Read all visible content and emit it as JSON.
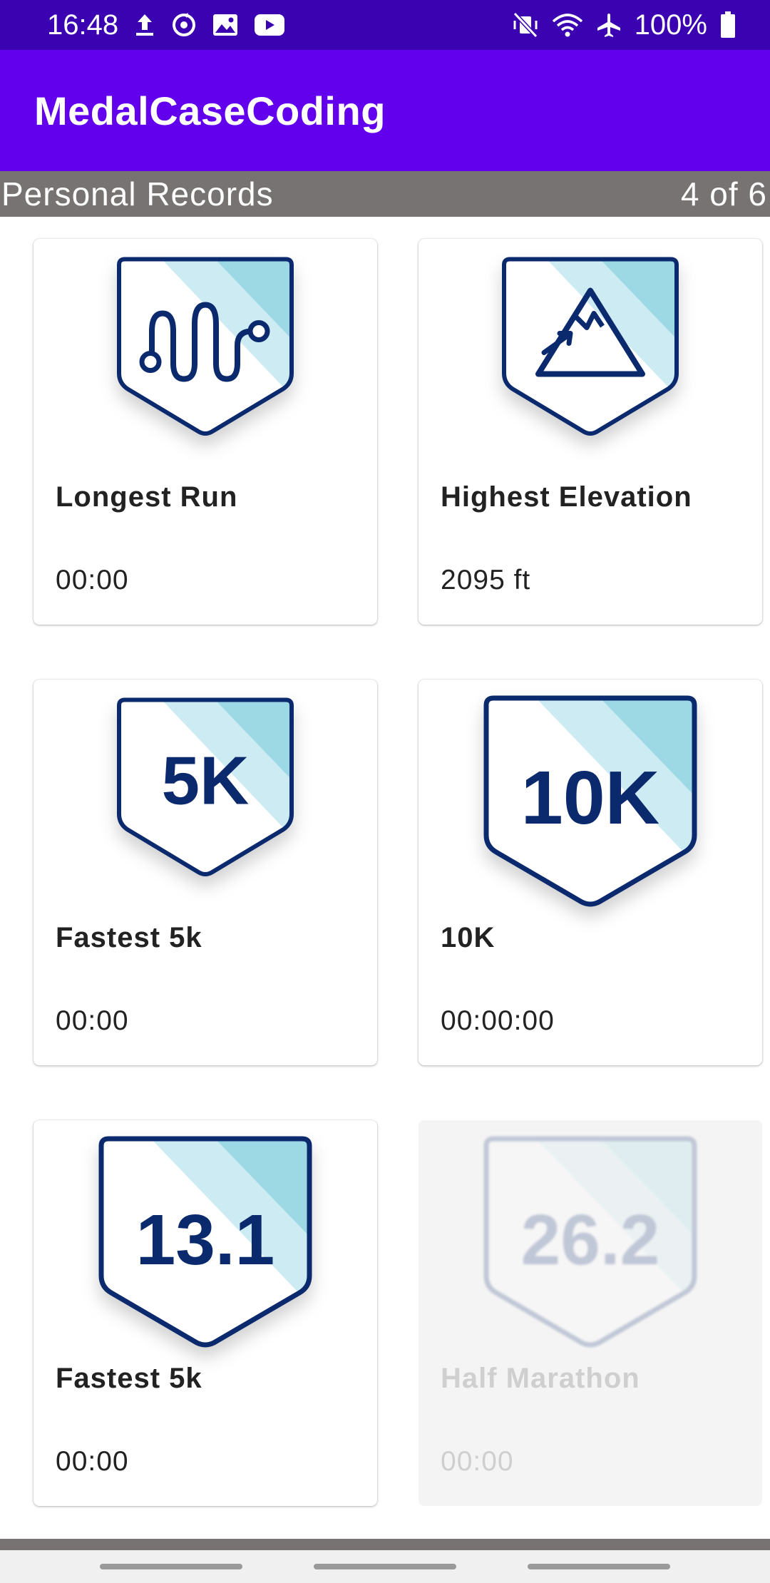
{
  "status_bar": {
    "time": "16:48",
    "battery": "100%",
    "left_icons": [
      "upload-icon",
      "sync-icon",
      "image-icon",
      "youtube-icon"
    ],
    "right_icons": [
      "vibrate-off-icon",
      "wifi-icon",
      "airplane-icon",
      "battery-icon"
    ]
  },
  "app_bar": {
    "title": "MedalCaseCoding"
  },
  "section": {
    "title": "Personal Records",
    "count": "4 of 6"
  },
  "cards": [
    {
      "title": "Longest Run",
      "value": "00:00",
      "badge": "route-badge",
      "locked": false
    },
    {
      "title": "Highest Elevation",
      "value": "2095 ft",
      "badge": "mountain-badge",
      "locked": false
    },
    {
      "title": "Fastest 5k",
      "value": "00:00",
      "badge_text": "5K",
      "locked": false
    },
    {
      "title": "10K",
      "value": "00:00:00",
      "badge_text": "10K",
      "locked": false
    },
    {
      "title": "Fastest 5k",
      "value": "00:00",
      "badge_text": "13.1",
      "locked": false
    },
    {
      "title": "Half Marathon",
      "value": "00:00",
      "badge_text": "26.2",
      "locked": true
    }
  ],
  "colors": {
    "status_bar": "#3a02b0",
    "app_bar": "#6200ee",
    "section_header": "#777373",
    "badge_outline": "#0b2a6e",
    "badge_light": "#cdebf2",
    "badge_dark": "#9cd9e5"
  }
}
